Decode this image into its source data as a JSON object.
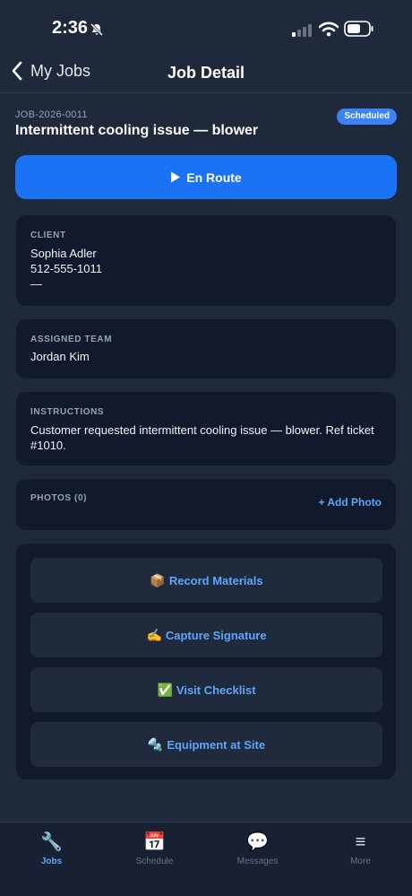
{
  "status_bar": {
    "time": "2:36"
  },
  "nav": {
    "back_label": "My Jobs",
    "title": "Job Detail"
  },
  "job": {
    "id": "JOB-2026-0011",
    "status": "Scheduled",
    "title": "Intermittent cooling issue — blower"
  },
  "primary_action": {
    "label": "En Route",
    "icon": "play-icon"
  },
  "client": {
    "label": "CLIENT",
    "name": "Sophia Adler",
    "phone": "512-555-1011",
    "extra": "—"
  },
  "team": {
    "label": "ASSIGNED TEAM",
    "member": "Jordan Kim"
  },
  "instructions": {
    "label": "INSTRUCTIONS",
    "text": "Customer requested intermittent cooling issue — blower. Ref ticket #1010."
  },
  "photos": {
    "label": "PHOTOS (0)",
    "add_label": "+ Add Photo"
  },
  "actions": [
    {
      "emoji": "📦",
      "label": "Record Materials"
    },
    {
      "emoji": "✍️",
      "label": "Capture Signature"
    },
    {
      "emoji": "✅",
      "label": "Visit Checklist"
    },
    {
      "emoji": "🔩",
      "label": "Equipment at Site"
    }
  ],
  "tabs": [
    {
      "icon": "🔧",
      "label": "Jobs",
      "active": true
    },
    {
      "icon": "📅",
      "label": "Schedule"
    },
    {
      "icon": "💬",
      "label": "Messages"
    },
    {
      "icon": "≡",
      "label": "More"
    }
  ],
  "colors": {
    "accent": "#1a73f5",
    "badge": "#3b82f6",
    "link": "#60a5fa",
    "background": "#1e293b",
    "card": "#111a2c"
  }
}
